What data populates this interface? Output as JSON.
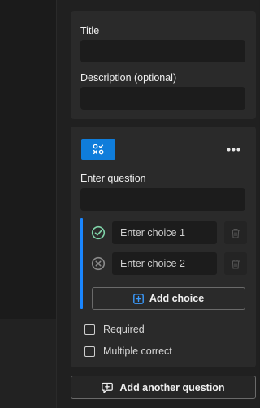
{
  "details": {
    "title_label": "Title",
    "title_value": "",
    "description_label": "Description (optional)",
    "description_value": ""
  },
  "question": {
    "type_icon": "choice-question-icon",
    "more_icon": "more-options-icon",
    "more_label": "•••",
    "question_label": "Enter question",
    "question_value": "",
    "choices": [
      {
        "placeholder": "Enter choice 1",
        "status": "correct",
        "status_icon": "check-circle-icon",
        "delete_icon": "trash-icon"
      },
      {
        "placeholder": "Enter choice 2",
        "status": "incorrect",
        "status_icon": "x-circle-icon",
        "delete_icon": "trash-icon"
      }
    ],
    "add_choice_label": "Add choice",
    "options": {
      "required_label": "Required",
      "required_checked": false,
      "multiple_correct_label": "Multiple correct",
      "multiple_correct_checked": false
    }
  },
  "footer": {
    "add_question_label": "Add another question"
  },
  "colors": {
    "accent": "#0f7ddb",
    "rail": "#1a86ff",
    "correct": "#7fd3a8",
    "incorrect": "#8a8a8a"
  }
}
